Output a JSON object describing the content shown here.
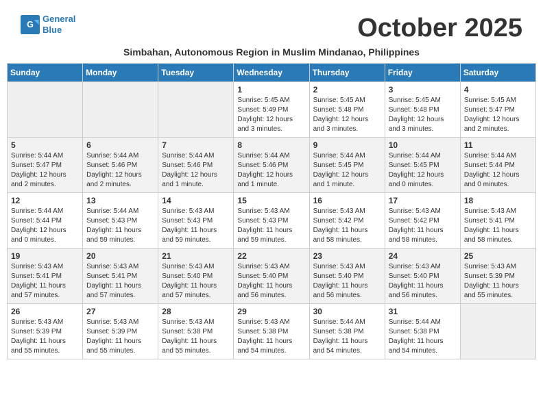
{
  "header": {
    "logo_line1": "General",
    "logo_line2": "Blue",
    "month_title": "October 2025",
    "subtitle": "Simbahan, Autonomous Region in Muslim Mindanao, Philippines"
  },
  "calendar": {
    "weekdays": [
      "Sunday",
      "Monday",
      "Tuesday",
      "Wednesday",
      "Thursday",
      "Friday",
      "Saturday"
    ],
    "weeks": [
      [
        {
          "day": "",
          "info": ""
        },
        {
          "day": "",
          "info": ""
        },
        {
          "day": "",
          "info": ""
        },
        {
          "day": "1",
          "info": "Sunrise: 5:45 AM\nSunset: 5:49 PM\nDaylight: 12 hours and 3 minutes."
        },
        {
          "day": "2",
          "info": "Sunrise: 5:45 AM\nSunset: 5:48 PM\nDaylight: 12 hours and 3 minutes."
        },
        {
          "day": "3",
          "info": "Sunrise: 5:45 AM\nSunset: 5:48 PM\nDaylight: 12 hours and 3 minutes."
        },
        {
          "day": "4",
          "info": "Sunrise: 5:45 AM\nSunset: 5:47 PM\nDaylight: 12 hours and 2 minutes."
        }
      ],
      [
        {
          "day": "5",
          "info": "Sunrise: 5:44 AM\nSunset: 5:47 PM\nDaylight: 12 hours and 2 minutes."
        },
        {
          "day": "6",
          "info": "Sunrise: 5:44 AM\nSunset: 5:46 PM\nDaylight: 12 hours and 2 minutes."
        },
        {
          "day": "7",
          "info": "Sunrise: 5:44 AM\nSunset: 5:46 PM\nDaylight: 12 hours and 1 minute."
        },
        {
          "day": "8",
          "info": "Sunrise: 5:44 AM\nSunset: 5:46 PM\nDaylight: 12 hours and 1 minute."
        },
        {
          "day": "9",
          "info": "Sunrise: 5:44 AM\nSunset: 5:45 PM\nDaylight: 12 hours and 1 minute."
        },
        {
          "day": "10",
          "info": "Sunrise: 5:44 AM\nSunset: 5:45 PM\nDaylight: 12 hours and 0 minutes."
        },
        {
          "day": "11",
          "info": "Sunrise: 5:44 AM\nSunset: 5:44 PM\nDaylight: 12 hours and 0 minutes."
        }
      ],
      [
        {
          "day": "12",
          "info": "Sunrise: 5:44 AM\nSunset: 5:44 PM\nDaylight: 12 hours and 0 minutes."
        },
        {
          "day": "13",
          "info": "Sunrise: 5:44 AM\nSunset: 5:43 PM\nDaylight: 11 hours and 59 minutes."
        },
        {
          "day": "14",
          "info": "Sunrise: 5:43 AM\nSunset: 5:43 PM\nDaylight: 11 hours and 59 minutes."
        },
        {
          "day": "15",
          "info": "Sunrise: 5:43 AM\nSunset: 5:43 PM\nDaylight: 11 hours and 59 minutes."
        },
        {
          "day": "16",
          "info": "Sunrise: 5:43 AM\nSunset: 5:42 PM\nDaylight: 11 hours and 58 minutes."
        },
        {
          "day": "17",
          "info": "Sunrise: 5:43 AM\nSunset: 5:42 PM\nDaylight: 11 hours and 58 minutes."
        },
        {
          "day": "18",
          "info": "Sunrise: 5:43 AM\nSunset: 5:41 PM\nDaylight: 11 hours and 58 minutes."
        }
      ],
      [
        {
          "day": "19",
          "info": "Sunrise: 5:43 AM\nSunset: 5:41 PM\nDaylight: 11 hours and 57 minutes."
        },
        {
          "day": "20",
          "info": "Sunrise: 5:43 AM\nSunset: 5:41 PM\nDaylight: 11 hours and 57 minutes."
        },
        {
          "day": "21",
          "info": "Sunrise: 5:43 AM\nSunset: 5:40 PM\nDaylight: 11 hours and 57 minutes."
        },
        {
          "day": "22",
          "info": "Sunrise: 5:43 AM\nSunset: 5:40 PM\nDaylight: 11 hours and 56 minutes."
        },
        {
          "day": "23",
          "info": "Sunrise: 5:43 AM\nSunset: 5:40 PM\nDaylight: 11 hours and 56 minutes."
        },
        {
          "day": "24",
          "info": "Sunrise: 5:43 AM\nSunset: 5:40 PM\nDaylight: 11 hours and 56 minutes."
        },
        {
          "day": "25",
          "info": "Sunrise: 5:43 AM\nSunset: 5:39 PM\nDaylight: 11 hours and 55 minutes."
        }
      ],
      [
        {
          "day": "26",
          "info": "Sunrise: 5:43 AM\nSunset: 5:39 PM\nDaylight: 11 hours and 55 minutes."
        },
        {
          "day": "27",
          "info": "Sunrise: 5:43 AM\nSunset: 5:39 PM\nDaylight: 11 hours and 55 minutes."
        },
        {
          "day": "28",
          "info": "Sunrise: 5:43 AM\nSunset: 5:38 PM\nDaylight: 11 hours and 55 minutes."
        },
        {
          "day": "29",
          "info": "Sunrise: 5:43 AM\nSunset: 5:38 PM\nDaylight: 11 hours and 54 minutes."
        },
        {
          "day": "30",
          "info": "Sunrise: 5:44 AM\nSunset: 5:38 PM\nDaylight: 11 hours and 54 minutes."
        },
        {
          "day": "31",
          "info": "Sunrise: 5:44 AM\nSunset: 5:38 PM\nDaylight: 11 hours and 54 minutes."
        },
        {
          "day": "",
          "info": ""
        }
      ]
    ]
  }
}
